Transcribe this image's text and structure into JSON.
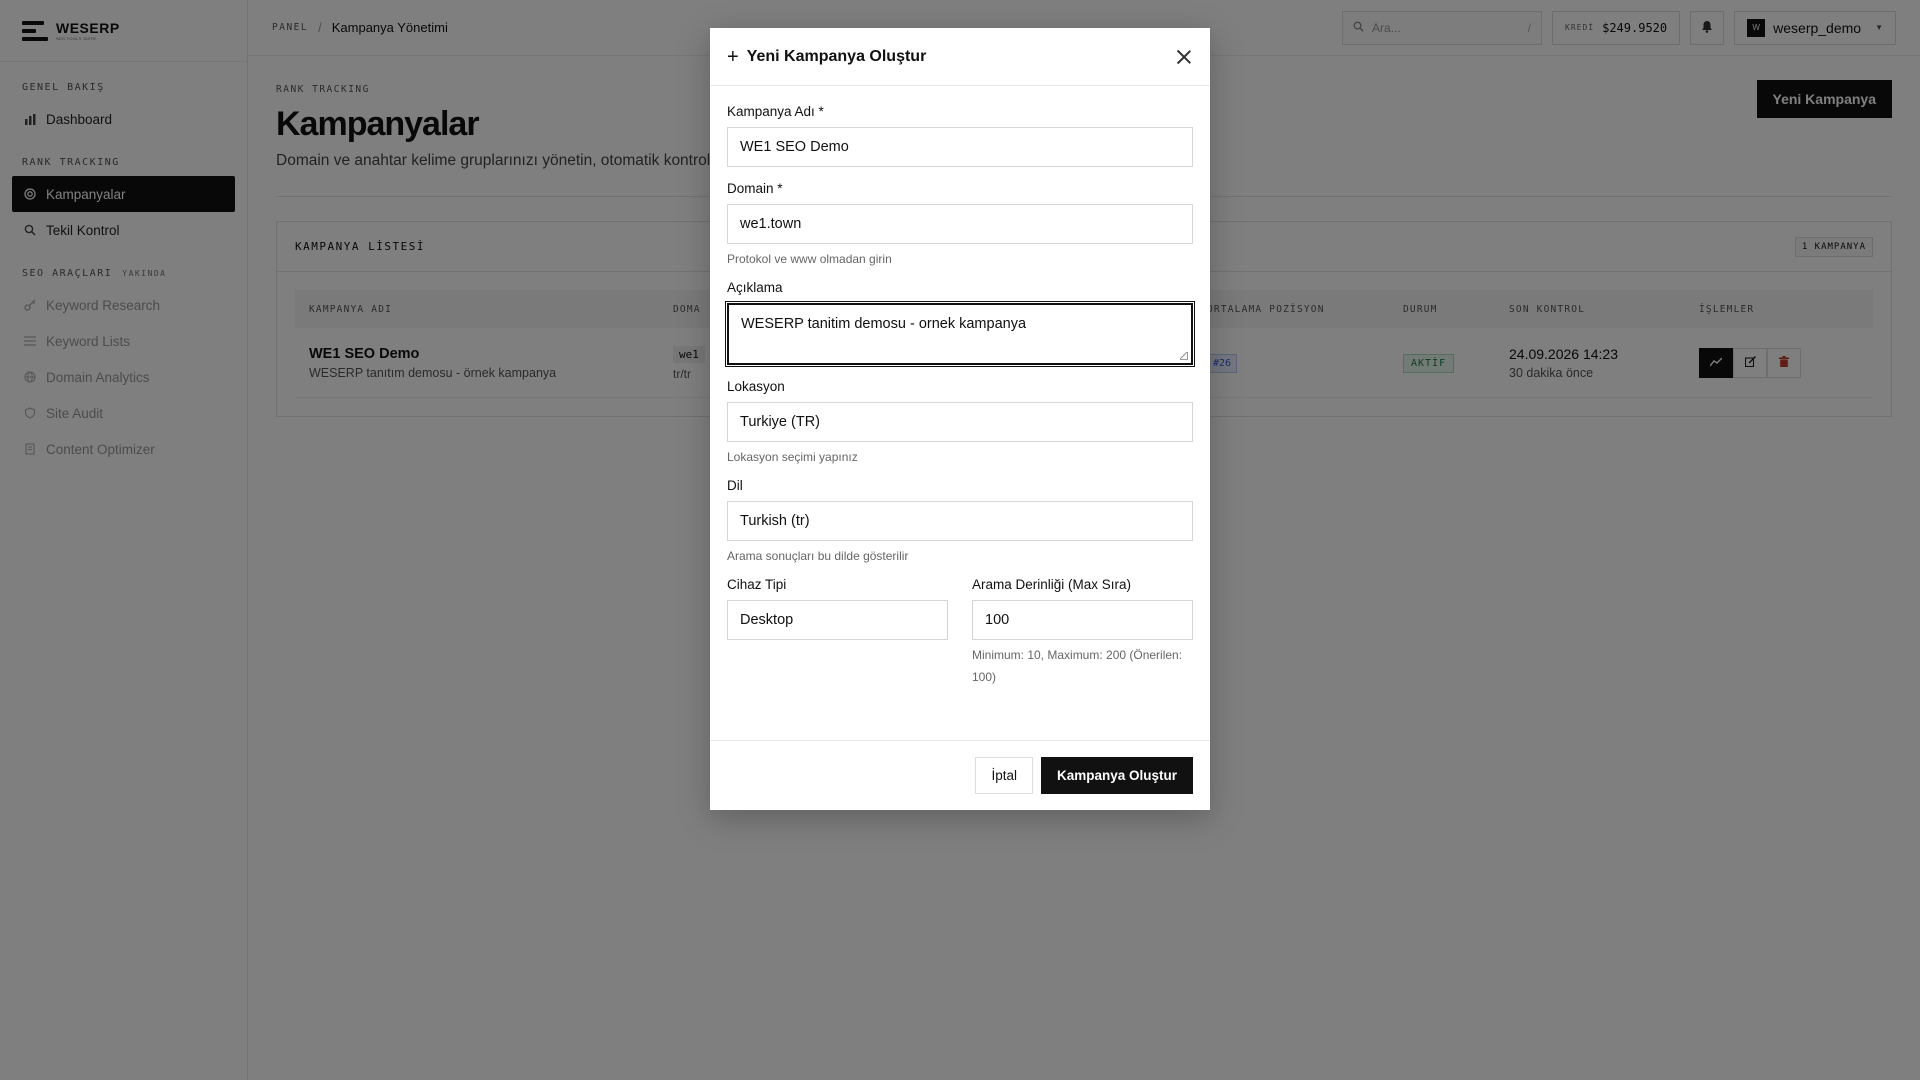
{
  "brand": {
    "name": "WESERP",
    "tagline": "SEO TOOLS SUITE"
  },
  "sidebar": {
    "sections": [
      {
        "title": "GENEL BAKIŞ"
      },
      {
        "title": "RANK TRACKING"
      },
      {
        "title": "SEO ARAÇLARI",
        "badge": "YAKINDA"
      }
    ],
    "items": [
      {
        "label": "Dashboard",
        "icon": "bar-chart-icon"
      },
      {
        "label": "Kampanyalar",
        "icon": "target-icon",
        "active": true
      },
      {
        "label": "Tekil Kontrol",
        "icon": "search-icon"
      },
      {
        "label": "Keyword Research",
        "icon": "key-icon",
        "disabled": true
      },
      {
        "label": "Keyword Lists",
        "icon": "list-icon",
        "disabled": true
      },
      {
        "label": "Domain Analytics",
        "icon": "globe-icon",
        "disabled": true
      },
      {
        "label": "Site Audit",
        "icon": "audit-icon",
        "disabled": true
      },
      {
        "label": "Content Optimizer",
        "icon": "document-icon",
        "disabled": true
      }
    ]
  },
  "topbar": {
    "breadcrumb_root": "PANEL",
    "breadcrumb_sep": "/",
    "breadcrumb_current": "Kampanya Yönetimi",
    "search_placeholder": "Ara...",
    "search_shortcut": "/",
    "credit_label": "KREDİ",
    "credit_value": "$249.9520",
    "username": "weserp_demo",
    "avatar_letter": "W"
  },
  "page": {
    "eyebrow": "RANK TRACKING",
    "title": "Kampanyalar",
    "description": "Domain ve anahtar kelime gruplarınızı yönetin, otomatik kontroll",
    "new_button": "Yeni Kampanya"
  },
  "campaign_list": {
    "title": "KAMPANYA LİSTESİ",
    "count": "1 KAMPANYA",
    "columns": [
      "KAMPANYA ADI",
      "DOMA",
      "ORTALAMA POZİSYON",
      "DURUM",
      "SON KONTROL",
      "İŞLEMLER"
    ],
    "rows": [
      {
        "name": "WE1 SEO Demo",
        "description": "WESERP tanıtım demosu - örnek kampanya",
        "domain_chip": "we1",
        "domain_loc": "tr/tr",
        "avg_position": "#26",
        "status": "AKTİF",
        "last_check_date": "24.09.2026 14:23",
        "last_check_ago": "30 dakika önce"
      }
    ]
  },
  "modal": {
    "title": "Yeni Kampanya Oluştur",
    "fields": {
      "name": {
        "label": "Kampanya Adı *",
        "value": "WE1 SEO Demo"
      },
      "domain": {
        "label": "Domain *",
        "value": "we1.town",
        "hint": "Protokol ve www olmadan girin"
      },
      "description": {
        "label": "Açıklama",
        "value": "WESERP tanitim demosu - ornek kampanya"
      },
      "location": {
        "label": "Lokasyon",
        "value": "Turkiye (TR)",
        "hint": "Lokasyon seçimi yapınız"
      },
      "language": {
        "label": "Dil",
        "value": "Turkish (tr)",
        "hint": "Arama sonuçları bu dilde gösterilir"
      },
      "device": {
        "label": "Cihaz Tipi",
        "value": "Desktop"
      },
      "depth": {
        "label": "Arama Derinliği (Max Sıra)",
        "value": "100",
        "hint": "Minimum: 10, Maximum: 200 (Önerilen: 100)"
      }
    },
    "cancel_label": "İptal",
    "submit_label": "Kampanya Oluştur"
  }
}
